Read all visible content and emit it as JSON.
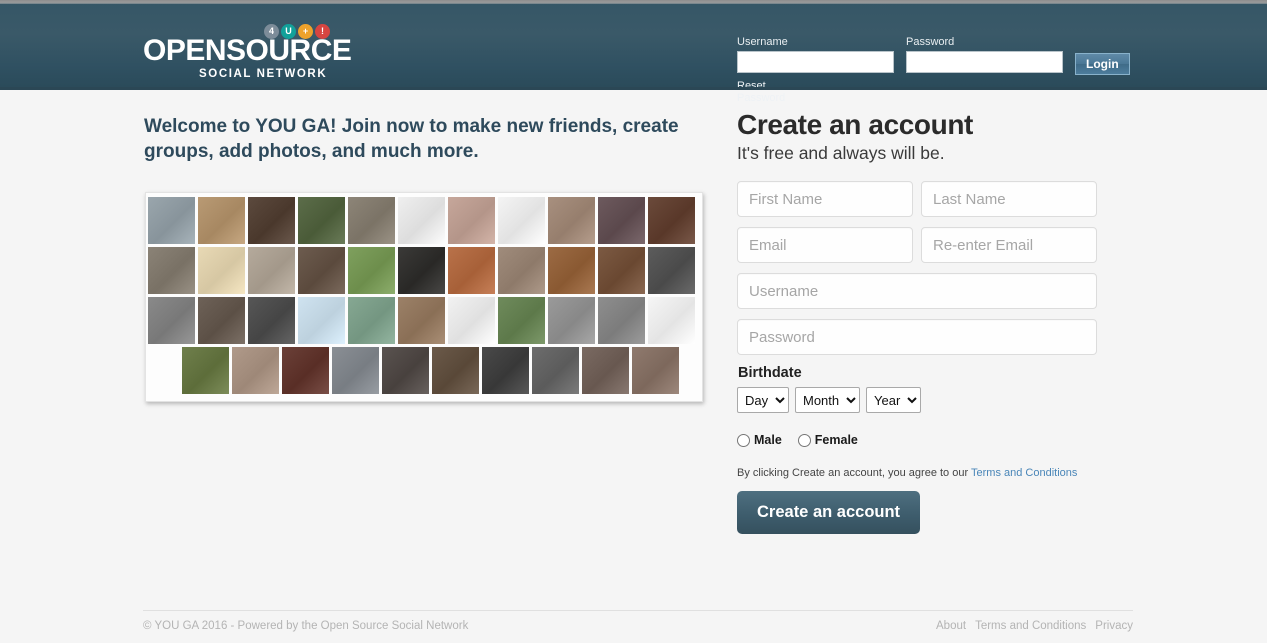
{
  "header": {
    "logo": {
      "main": "OPENSOURCE",
      "sub": "SOCIAL NETWORK",
      "badges": [
        {
          "text": "4",
          "color": "#7c8c99"
        },
        {
          "text": "U",
          "color": "#12a19a"
        },
        {
          "text": "+",
          "color": "#eda22c"
        },
        {
          "text": "!",
          "color": "#d64541"
        }
      ]
    },
    "login": {
      "username_label": "Username",
      "username_value": "",
      "username_placeholder": "",
      "password_label": "Password",
      "password_value": "",
      "password_placeholder": "",
      "login_button": "Login",
      "reset_password": "Reset Password"
    }
  },
  "left": {
    "welcome_heading": "Welcome to YOU GA! Join now to make new friends, create groups, add photos, and much more.",
    "avatar_grid": {
      "rows": [
        [
          {
            "name": "avatar-man-sunglasses",
            "color": "#9aa6ad"
          },
          {
            "name": "avatar-man-straw-hat",
            "color": "#b99a74"
          },
          {
            "name": "avatar-man-cowboy-hat",
            "color": "#5c4a3e"
          },
          {
            "name": "avatar-man-green-shirt",
            "color": "#5c6d4a"
          },
          {
            "name": "avatar-man-hand-chin",
            "color": "#8d8578"
          },
          {
            "name": "avatar-dragon-emblem",
            "color": "#efefef"
          },
          {
            "name": "avatar-man-santa-hat",
            "color": "#c6a79b"
          },
          {
            "name": "avatar-green-bat-cartoon",
            "color": "#f4f4f4"
          },
          {
            "name": "avatar-man-smiling",
            "color": "#a8907f"
          },
          {
            "name": "avatar-man-dark-shirt",
            "color": "#6d5a5e"
          },
          {
            "name": "avatar-woman-smiling",
            "color": "#6b4a3b"
          }
        ],
        [
          {
            "name": "avatar-man-indoors",
            "color": "#8b8377"
          },
          {
            "name": "avatar-owl-cartoon",
            "color": "#e8d9b5"
          },
          {
            "name": "avatar-bw-portrait",
            "color": "#b5aa9c"
          },
          {
            "name": "avatar-man-beard",
            "color": "#6d5c4f"
          },
          {
            "name": "avatar-caricature-face",
            "color": "#7fa05e"
          },
          {
            "name": "avatar-man-suit",
            "color": "#3b3a38"
          },
          {
            "name": "avatar-man-orange-light",
            "color": "#b9724a"
          },
          {
            "name": "avatar-man-stubble",
            "color": "#a08c7c"
          },
          {
            "name": "avatar-man-outdoors",
            "color": "#9c6b44"
          },
          {
            "name": "avatar-man-laughing",
            "color": "#7c5a43"
          },
          {
            "name": "avatar-man-cap",
            "color": "#5c5c5c"
          }
        ],
        [
          {
            "name": "avatar-woman-bw",
            "color": "#8a8a8a"
          },
          {
            "name": "avatar-person-bw-portrait",
            "color": "#6e6258"
          },
          {
            "name": "avatar-man-glasses-bw",
            "color": "#575757"
          },
          {
            "name": "avatar-girl-cartoon",
            "color": "#cfe3f0"
          },
          {
            "name": "avatar-landscape-photo",
            "color": "#86a893"
          },
          {
            "name": "avatar-woman-glasses",
            "color": "#9c8168"
          },
          {
            "name": "avatar-blue-monster-cartoon",
            "color": "#f2f2f2"
          },
          {
            "name": "avatar-man-green-tshirt",
            "color": "#6f8b5c"
          },
          {
            "name": "avatar-person-short-hair",
            "color": "#9a9a9a"
          },
          {
            "name": "avatar-face-bw-closeup",
            "color": "#8e8e8e"
          },
          {
            "name": "avatar-blue-creature-cartoon",
            "color": "#f6f6f6"
          }
        ],
        [
          {
            "name": "avatar-green-texture",
            "color": "#6f7f4c"
          },
          {
            "name": "avatar-woman-scarf",
            "color": "#b09a8a"
          },
          {
            "name": "avatar-man-pointing",
            "color": "#6b4038"
          },
          {
            "name": "avatar-young-man-suit",
            "color": "#8a8f95"
          },
          {
            "name": "avatar-bald-man",
            "color": "#5a5350"
          },
          {
            "name": "avatar-man-beard-books",
            "color": "#6b5a4a"
          },
          {
            "name": "avatar-man-glasses-dark",
            "color": "#4a4a4a"
          },
          {
            "name": "avatar-woman-glasses-bw",
            "color": "#6d6d6d"
          },
          {
            "name": "avatar-woman-looking-down",
            "color": "#7a6a62"
          },
          {
            "name": "avatar-woman-portrait",
            "color": "#8f7a6e"
          }
        ]
      ]
    }
  },
  "signup": {
    "title": "Create an account",
    "subtitle": "It's free and always will be.",
    "fields": {
      "first_name": {
        "placeholder": "First Name",
        "value": ""
      },
      "last_name": {
        "placeholder": "Last Name",
        "value": ""
      },
      "email": {
        "placeholder": "Email",
        "value": ""
      },
      "reenter_email": {
        "placeholder": "Re-enter Email",
        "value": ""
      },
      "username": {
        "placeholder": "Username",
        "value": ""
      },
      "password": {
        "placeholder": "Password",
        "value": ""
      }
    },
    "birthdate": {
      "label": "Birthdate",
      "day": {
        "selected": "Day",
        "options": [
          "Day"
        ]
      },
      "month": {
        "selected": "Month",
        "options": [
          "Month"
        ]
      },
      "year": {
        "selected": "Year",
        "options": [
          "Year"
        ]
      }
    },
    "gender": {
      "male": "Male",
      "female": "Female",
      "selected": ""
    },
    "terms_note": "By clicking Create an account, you agree to our ",
    "terms_link": "Terms and Conditions",
    "submit_button": "Create an account"
  },
  "footer": {
    "copyright": "© YOU GA 2016 - Powered by the Open Source Social Network",
    "links": [
      "About",
      "Terms and Conditions",
      "Privacy"
    ]
  },
  "colors": {
    "header_top": "#3e5d6d",
    "header_bottom": "#2a4a59",
    "page_bg": "#f5f5f5",
    "heading_blue": "#2e4a5c",
    "link_blue": "#4a86b8",
    "button_dark": "#3e5d6d"
  }
}
